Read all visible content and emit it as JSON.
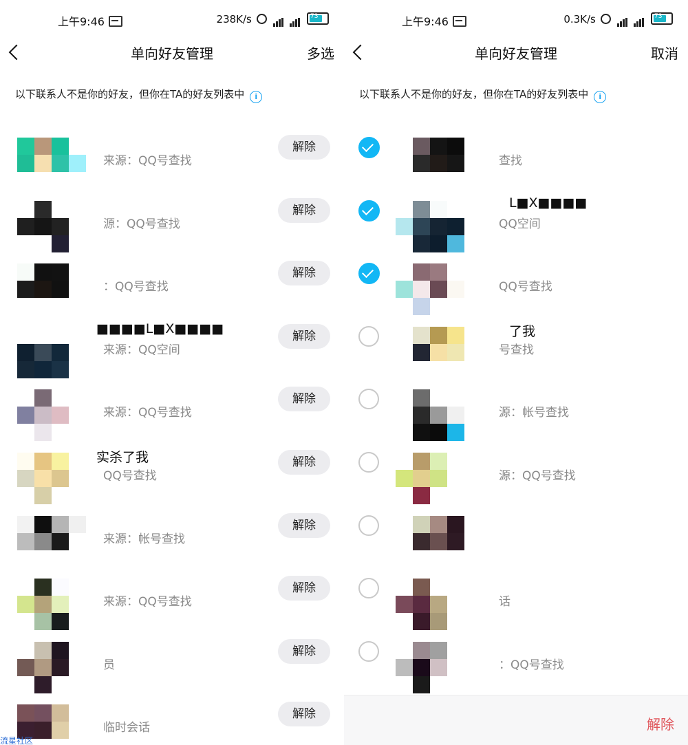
{
  "left": {
    "status": {
      "time": "上午9:46",
      "speed": "238K/s",
      "battery": "73"
    },
    "nav": {
      "title": "单向好友管理",
      "action": "多选"
    },
    "notice": "以下联系人不是你的好友，但你在TA的好友列表中",
    "unbind_label": "解除",
    "rows": [
      {
        "name": "",
        "source": "来源：QQ号查找",
        "avatar": [
          "#20c89b",
          "#b9977a",
          "#19c19c",
          "#ffffff",
          "#1fbd96",
          "#f6dfb0",
          "#2ec2a8",
          "#9ff0fb",
          "#ffffff",
          "#ffffff",
          "#ffffff",
          "#ffffff"
        ]
      },
      {
        "name": "",
        "source": "源：QQ号查找",
        "avatar": [
          "#ffffff",
          "#2a2a2a",
          "#ffffff",
          "#ffffff",
          "#1f1f1f",
          "#151515",
          "#222222",
          "#ffffff",
          "#ffffff",
          "#ffffff",
          "#222033",
          "#ffffff"
        ]
      },
      {
        "name": "",
        "source": "：QQ号查找",
        "avatar": [
          "#f7fbf8",
          "#111111",
          "#121212",
          "#ffffff",
          "#1c1c1c",
          "#1c1612",
          "#111111",
          "#ffffff",
          "#ffffff",
          "#ffffff",
          "#ffffff",
          "#ffffff"
        ]
      },
      {
        "name": "■■■■L■X■■■■",
        "source": "来源：QQ空间",
        "avatar": [
          "#ffffff",
          "#ffffff",
          "#ffffff",
          "#ffffff",
          "#0f2030",
          "#3a4a58",
          "#12283a",
          "#ffffff",
          "#162838",
          "#10263a",
          "#1a3246",
          "#ffffff"
        ]
      },
      {
        "name": "",
        "source": "来源：QQ号查找",
        "avatar": [
          "#ffffff",
          "#7a6a75",
          "#ffffff",
          "#ffffff",
          "#8080a0",
          "#cbbcc6",
          "#dfbcc3",
          "#ffffff",
          "#ffffff",
          "#ebe6ec",
          "#ffffff",
          "#ffffff"
        ]
      },
      {
        "name": "实杀了我",
        "source": "QQ号查找",
        "avatar": [
          "#fffcf0",
          "#e6c582",
          "#f8f2a0",
          "#ffffff",
          "#d7d6c1",
          "#f8e0a8",
          "#dcc68f",
          "#ffffff",
          "#ffffff",
          "#d7cfa8",
          "#ffffff",
          "#ffffff"
        ]
      },
      {
        "name": "",
        "source": "来源：帐号查找",
        "avatar": [
          "#f2f2f2",
          "#0f0f0f",
          "#b5b5b5",
          "#f0f0f0",
          "#bcbcbc",
          "#8a8a8a",
          "#1a1a1a",
          "#ffffff",
          "#ffffff",
          "#ffffff",
          "#ffffff",
          "#ffffff"
        ]
      },
      {
        "name": "",
        "source": "来源：QQ号查找",
        "avatar": [
          "#ffffff",
          "#2a3020",
          "#fbfbff",
          "#ffffff",
          "#d4e58e",
          "#b4a37a",
          "#e3f0bb",
          "#ffffff",
          "#ffffff",
          "#a7c2a5",
          "#181d1d",
          "#ffffff"
        ]
      },
      {
        "name": "",
        "source": "员",
        "avatar": [
          "#ffffff",
          "#c8c0b0",
          "#1f1520",
          "#ffffff",
          "#735a55",
          "#b09a82",
          "#2a1a25",
          "#ffffff",
          "#ffffff",
          "#2e1c2a",
          "#ffffff",
          "#ffffff"
        ]
      },
      {
        "name": "",
        "source": "临时会话",
        "avatar": [
          "#7a5258",
          "#74505f",
          "#d2bd9a",
          "#ffffff",
          "#3b1f30",
          "#3a1f2b",
          "#e0cfa8",
          "#ffffff",
          "#ffffff",
          "#ffffff",
          "#ffffff",
          "#ffffff"
        ]
      }
    ]
  },
  "right": {
    "status": {
      "time": "上午9:46",
      "speed": "0.3K/s",
      "battery": "73"
    },
    "nav": {
      "title": "单向好友管理",
      "action": "取消"
    },
    "notice": "以下联系人不是你的好友，但你在TA的好友列表中",
    "bottom_unbind": "解除",
    "rows": [
      {
        "checked": true,
        "name": "",
        "source": "查找",
        "avatar": [
          "#ffffff",
          "#6a5a60",
          "#141414",
          "#0c0c0c",
          "#ffffff",
          "#2a2a2a",
          "#211b18",
          "#161616",
          "#ffffff",
          "#ffffff",
          "#ffffff",
          "#ffffff"
        ]
      },
      {
        "checked": true,
        "name": "L■X■■■■",
        "source": "QQ空间",
        "avatar": [
          "#ffffff",
          "#7e8d96",
          "#f8fbfb",
          "#ffffff",
          "#b5e7ee",
          "#2d4556",
          "#152433",
          "#0e2030",
          "#ffffff",
          "#182838",
          "#0d1d2d",
          "#4fb8dd"
        ]
      },
      {
        "checked": true,
        "name": "",
        "source": "QQ号查找",
        "avatar": [
          "#ffffff",
          "#8a6a72",
          "#9a7a80",
          "#ffffff",
          "#9de3db",
          "#f4e8ea",
          "#6a4a54",
          "#fbf8f2",
          "#ffffff",
          "#c6d4ea",
          "#ffffff",
          "#ffffff"
        ]
      },
      {
        "checked": false,
        "name": "了我",
        "source": "号查找",
        "avatar": [
          "#ffffff",
          "#e4e2cc",
          "#b59a52",
          "#f6e48c",
          "#ffffff",
          "#222633",
          "#f6e0a6",
          "#efe7b2",
          "#ffffff",
          "#ffffff",
          "#ffffff",
          "#ffffff"
        ]
      },
      {
        "checked": false,
        "name": "",
        "source": "源：帐号查找",
        "avatar": [
          "#ffffff",
          "#6c6c6c",
          "#ffffff",
          "#ffffff",
          "#ffffff",
          "#2a2a2a",
          "#9a9a9a",
          "#f0f0f0",
          "#ffffff",
          "#101010",
          "#0b0b0b",
          "#1cb6e8"
        ]
      },
      {
        "checked": false,
        "name": "",
        "source": "源：QQ号查找",
        "avatar": [
          "#ffffff",
          "#b89c6a",
          "#dcefb4",
          "#ffffff",
          "#d4e67c",
          "#e2cf8e",
          "#cfe385",
          "#ffffff",
          "#ffffff",
          "#8a2a42",
          "#ffffff",
          "#ffffff"
        ]
      },
      {
        "checked": false,
        "name": "",
        "source": "",
        "avatar": [
          "#ffffff",
          "#d0d2b8",
          "#a68a82",
          "#2a1620",
          "#ffffff",
          "#3a2a2e",
          "#6a5050",
          "#2e1a24",
          "#ffffff",
          "#ffffff",
          "#ffffff",
          "#ffffff"
        ]
      },
      {
        "checked": false,
        "name": "",
        "source": "话",
        "avatar": [
          "#ffffff",
          "#7a5a50",
          "#ffffff",
          "#ffffff",
          "#7a4a5a",
          "#5a2a40",
          "#b8a882",
          "#ffffff",
          "#ffffff",
          "#3a1a2a",
          "#a89a78",
          "#ffffff"
        ]
      },
      {
        "checked": false,
        "name": "",
        "source": "：QQ号查找",
        "avatar": [
          "#ffffff",
          "#9a8a90",
          "#a0a0a0",
          "#ffffff",
          "#bcbcbc",
          "#1a0a1a",
          "#d0c0c4",
          "#ffffff",
          "#ffffff",
          "#1a1a1a",
          "#ffffff",
          "#ffffff"
        ]
      }
    ]
  },
  "watermark": "流星社区"
}
